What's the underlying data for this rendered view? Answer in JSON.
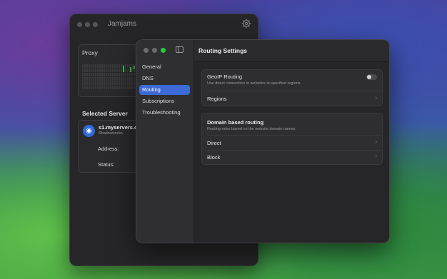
{
  "back_window": {
    "title": "Jamjams",
    "proxy_label": "Proxy",
    "selected_server_title": "Selected Server",
    "server": {
      "name": "s1.myservers.c",
      "protocol": "Shadowsocks",
      "address_label": "Address:",
      "status_label": "Status:"
    }
  },
  "front_window": {
    "sidebar": {
      "items": [
        {
          "label": "General"
        },
        {
          "label": "DNS"
        },
        {
          "label": "Routing"
        },
        {
          "label": "Subscriptions"
        },
        {
          "label": "Troubleshooting"
        }
      ],
      "selected": "Routing"
    },
    "title": "Routing Settings",
    "geoip": {
      "title": "GeoIP Routing",
      "subtitle": "Use direct connection to websites in specified regions.",
      "enabled": false,
      "regions_label": "Regions"
    },
    "domain": {
      "title": "Domain based routing",
      "subtitle": "Routing rules based on the website domain names",
      "direct_label": "Direct",
      "block_label": "Block"
    }
  },
  "colors": {
    "accent": "#3c6ad6",
    "traffic_red": "#ff5f57",
    "traffic_yellow": "#febc2e",
    "traffic_green": "#28c840",
    "graph_bar": "#3fbf4a"
  },
  "icons": [
    "gear-icon",
    "sidebar-toggle-icon",
    "server-globe-icon",
    "chevron-right-icon"
  ]
}
